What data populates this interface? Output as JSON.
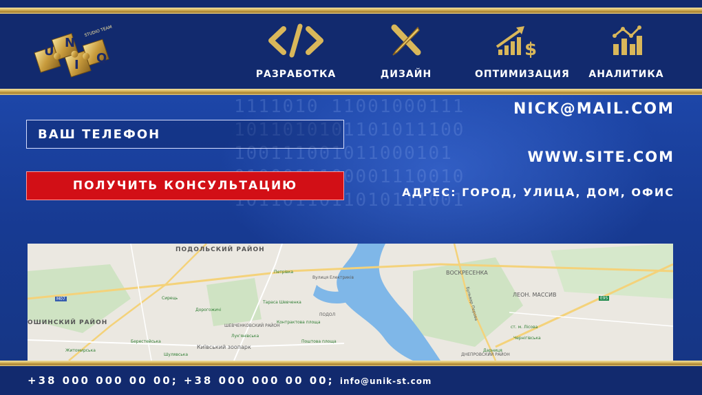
{
  "logo": {
    "letters": [
      "U",
      "N",
      "I",
      "Q"
    ],
    "tagline": "STUDIO TEAM"
  },
  "nav": {
    "items": [
      {
        "label": "РАЗРАБОТКА",
        "icon": "code-icon"
      },
      {
        "label": "ДИЗАЙН",
        "icon": "pencil-ruler-icon"
      },
      {
        "label": "ОПТИМИЗАЦИЯ",
        "icon": "growth-dollar-icon"
      },
      {
        "label": "АНАЛИТИКА",
        "icon": "analytics-chart-icon"
      }
    ]
  },
  "form": {
    "phone_placeholder": "ВАШ ТЕЛЕФОН",
    "cta_label": "ПОЛУЧИТЬ КОНСУЛЬТАЦИЮ"
  },
  "contact": {
    "email": "NICK@MAIL.COM",
    "site": "WWW.SITE.COM",
    "address": "АДРЕС: ГОРОД, УЛИЦА, ДОМ, ОФИС"
  },
  "map": {
    "labels": [
      "ПОДОЛЬСКИЙ РАЙОН",
      "ОШИНСКИЙ РАЙОН",
      "ВОСКРЕСЕНКА",
      "ЛЕОН. МАССИВ",
      "Петрівка",
      "Сирець",
      "Дорогожичі",
      "Тараса Шевченка",
      "Контрактова площа",
      "Лук'янівська",
      "Поштова площа",
      "Берестейська",
      "Київський зоопарк",
      "Шулявська",
      "Житомирська",
      "ШЕВЧЕНКОВСКИЙ РАЙОН",
      "ПОДОЛ",
      "ДНЕПРОВСКИЙ РАЙОН",
      "Дарниця",
      "Чернігівська",
      "ст. м. Лісова",
      "Бульвар Перова",
      "Вулиця Електриків",
      "M07",
      "E95"
    ]
  },
  "footer": {
    "phones": "+38 000 000 00 00; +38 000 000 00 00;",
    "email": "info@unik-st.com"
  }
}
